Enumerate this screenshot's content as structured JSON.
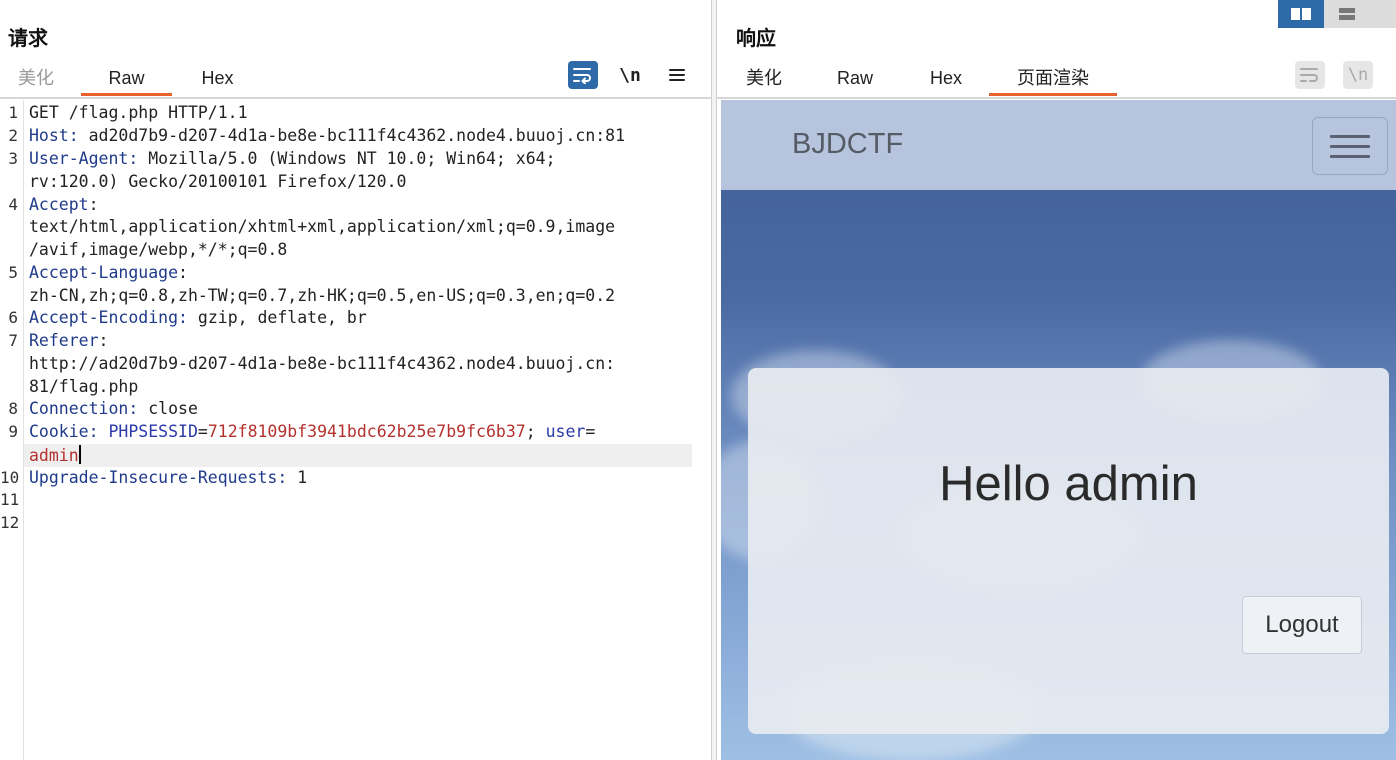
{
  "request": {
    "title": "请求",
    "tabs": [
      "美化",
      "Raw",
      "Hex"
    ],
    "active_tab": "Raw",
    "tools": {
      "newline_label": "\\n",
      "wrap_icon": "wrap-lines-icon",
      "menu_icon": "hamburger-menu-icon"
    },
    "line_numbers": [
      "1",
      "2",
      "3",
      "4",
      "5",
      "6",
      "7",
      "8",
      "9",
      "10",
      "11",
      "12"
    ],
    "lines": [
      {
        "text": "GET /flag.php HTTP/1.1"
      },
      {
        "key": "Host",
        "value": " ad20d7b9-d207-4d1a-be8e-bc111f4c4362.node4.buuoj.cn:81"
      },
      {
        "key": "User-Agent",
        "value": " Mozilla/5.0 (Windows NT 10.0; Win64; x64;",
        "cont": "rv:120.0) Gecko/20100101 Firefox/120.0"
      },
      {
        "key": "Accept",
        "value": ":",
        "cont": "text/html,application/xhtml+xml,application/xml;q=0.9,image",
        "cont2": "/avif,image/webp,*/*;q=0.8"
      },
      {
        "key": "Accept-Language",
        "value": ":",
        "cont": "zh-CN,zh;q=0.8,zh-TW;q=0.7,zh-HK;q=0.5,en-US;q=0.3,en;q=0.2"
      },
      {
        "key": "Accept-Encoding",
        "value": " gzip, deflate, br"
      },
      {
        "key": "Referer",
        "value": ":",
        "cont": "http://ad20d7b9-d207-4d1a-be8e-bc111f4c4362.node4.buuoj.cn:",
        "cont2": "81/flag.php"
      },
      {
        "key": "Connection",
        "value": " close"
      },
      {
        "key": "Cookie",
        "cookie_name": "PHPSESSID",
        "cookie_value": "712f8109bf3941bdc62b25e7b9fc6b37",
        "cookie2_name": "user",
        "cookie2_value": "admin"
      },
      {
        "key": "Upgrade-Insecure-Requests",
        "value": " 1"
      }
    ]
  },
  "response": {
    "title": "响应",
    "tabs": [
      "美化",
      "Raw",
      "Hex",
      "页面渲染"
    ],
    "active_tab": "页面渲染",
    "tools": {
      "newline_label": "\\n",
      "wrap_icon": "wrap-lines-icon"
    },
    "layout_toggle": {
      "icons": [
        "split-columns-icon",
        "split-rows-icon"
      ],
      "active": "split-columns-icon"
    },
    "rendered_page": {
      "brand": "BJDCTF",
      "menu_icon": "hamburger-menu-icon",
      "heading": "Hello admin",
      "logout_label": "Logout"
    }
  },
  "colors": {
    "accent_tab": "#e8612c",
    "primary_button": "#2e6aa8",
    "header_key": "#1f3a8a",
    "cookie_value": "#b5312d"
  }
}
